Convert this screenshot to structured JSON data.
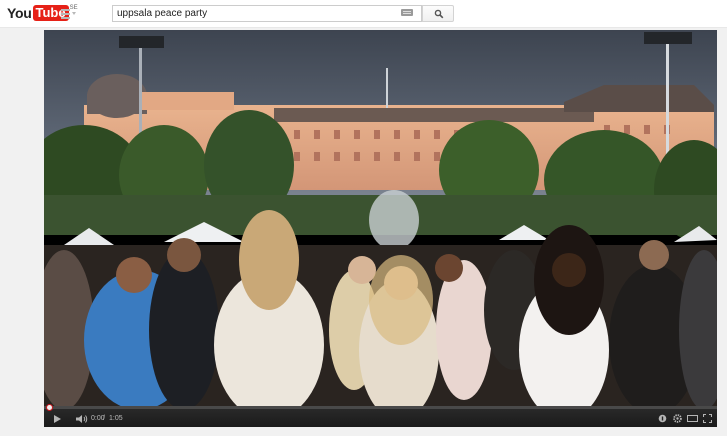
{
  "masthead": {
    "logo_you": "You",
    "logo_tube": "Tube",
    "logo_region": "SE",
    "search_value": "uppsala peace party"
  },
  "player": {
    "time_current": "0:00",
    "time_separator": "/",
    "time_duration": "1:05",
    "progress_fraction": 0.0,
    "icons": [
      "play-icon",
      "volume-icon",
      "captions-icon",
      "settings-icon",
      "theater-icon",
      "fullscreen-icon"
    ]
  },
  "colors": {
    "brand_red": "#e62117",
    "progress_red": "#cc181e",
    "control_bar": "#1b1b1b"
  }
}
